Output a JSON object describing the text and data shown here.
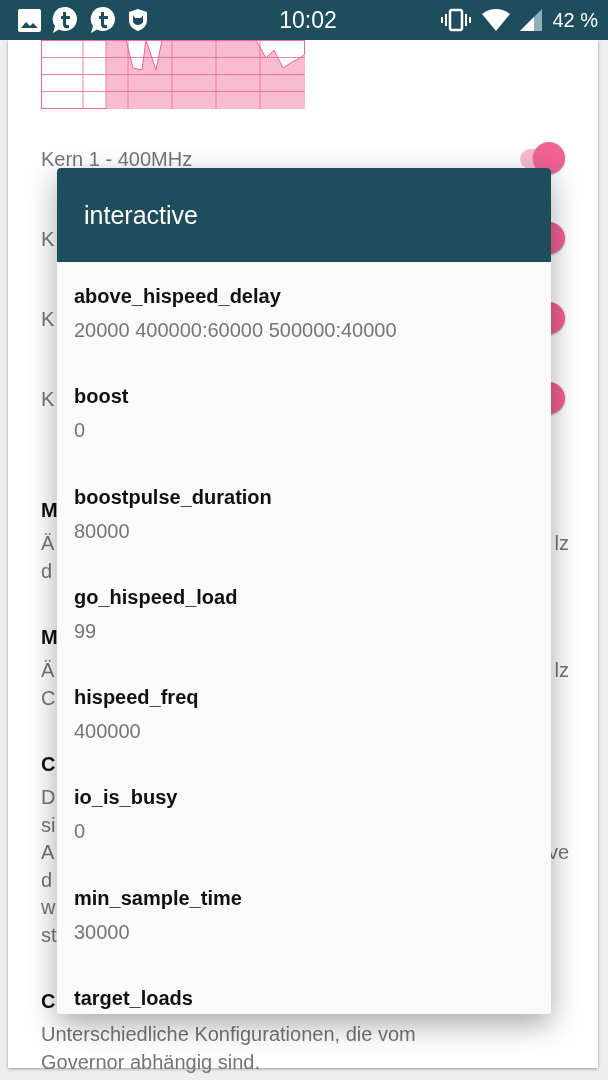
{
  "status_bar": {
    "time": "10:02",
    "battery": "42 %"
  },
  "cores": [
    {
      "label": "Kern 1 - 400MHz",
      "on": true
    },
    {
      "label": "K",
      "on": true
    },
    {
      "label": "K",
      "on": true
    },
    {
      "label": "K",
      "on": true
    }
  ],
  "sections": [
    {
      "title": "M",
      "lines": [
        {
          "left": "Ä",
          "right": "lz"
        },
        {
          "left": "d"
        }
      ]
    },
    {
      "title": "M",
      "lines": [
        {
          "left": "Ä",
          "right": "lz"
        },
        {
          "left": "C"
        }
      ]
    },
    {
      "title": "C",
      "lines": [
        {
          "left": "D"
        },
        {
          "left": "si"
        },
        {
          "left": "A",
          "right": "ve"
        },
        {
          "left": "d"
        },
        {
          "left": "w"
        },
        {
          "left": "st"
        }
      ]
    },
    {
      "title": "C",
      "lines": [
        {
          "left": "Unterschiedliche Konfigurationen, die vom"
        },
        {
          "left": "Governor abhängig sind."
        }
      ]
    }
  ],
  "dialog": {
    "title": "interactive",
    "items": [
      {
        "name": "above_hispeed_delay",
        "value": "20000 400000:60000 500000:40000"
      },
      {
        "name": "boost",
        "value": "0"
      },
      {
        "name": "boostpulse_duration",
        "value": "80000"
      },
      {
        "name": "go_hispeed_load",
        "value": "99"
      },
      {
        "name": "hispeed_freq",
        "value": "400000"
      },
      {
        "name": "io_is_busy",
        "value": "0"
      },
      {
        "name": "min_sample_time",
        "value": "30000"
      },
      {
        "name": "target_loads"
      }
    ]
  }
}
